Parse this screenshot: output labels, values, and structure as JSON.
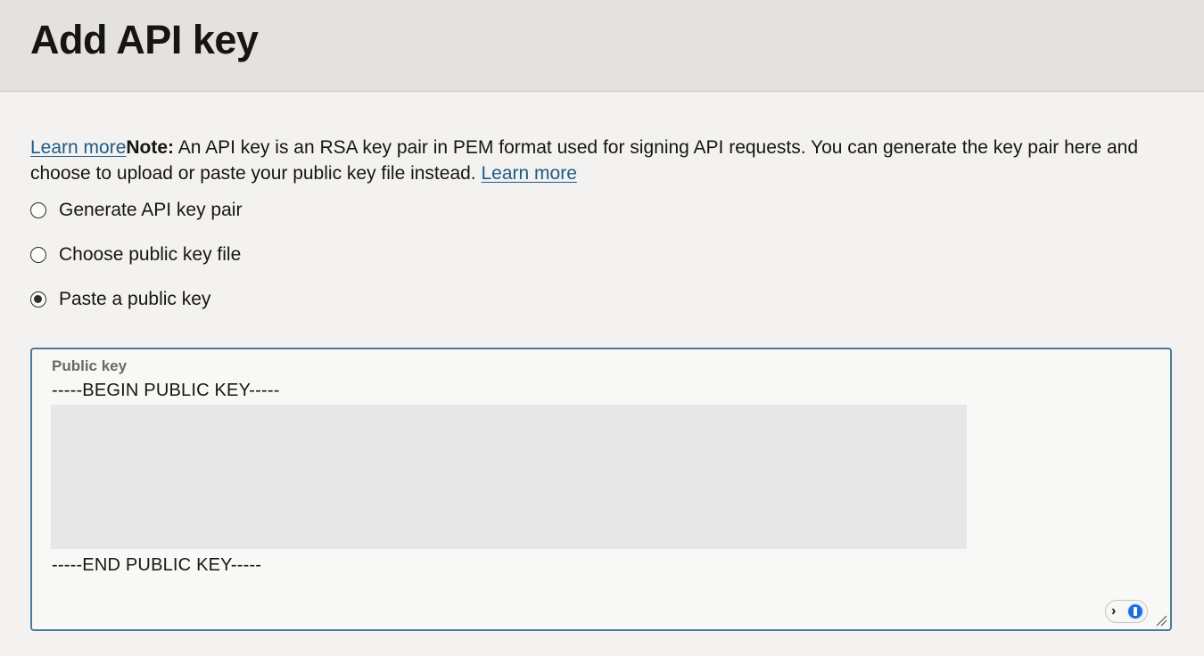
{
  "header": {
    "title": "Add API key"
  },
  "note": {
    "learn_more_1": "Learn more",
    "note_label": "Note:",
    "note_text_1": " An API key is an RSA key pair in PEM format used for signing API requests. You can generate the key pair here and",
    "note_text_2": "choose to upload or paste your public key file instead. ",
    "learn_more_2": "Learn more"
  },
  "options": [
    {
      "label": "Generate API key pair",
      "checked": false
    },
    {
      "label": "Choose public key file",
      "checked": false
    },
    {
      "label": "Paste a public key",
      "checked": true
    }
  ],
  "public_key": {
    "label": "Public key",
    "begin_line": "-----BEGIN PUBLIC KEY-----",
    "end_line": "-----END PUBLIC KEY-----"
  },
  "icons": {
    "chevron": "chevron-right-icon",
    "password_manager": "password-manager-icon",
    "resize": "resize-grip-icon"
  },
  "colors": {
    "link": "#1f5a87",
    "focus_border": "#4f7996",
    "header_bg": "#e4e2de",
    "page_bg": "#f3f2f0"
  }
}
